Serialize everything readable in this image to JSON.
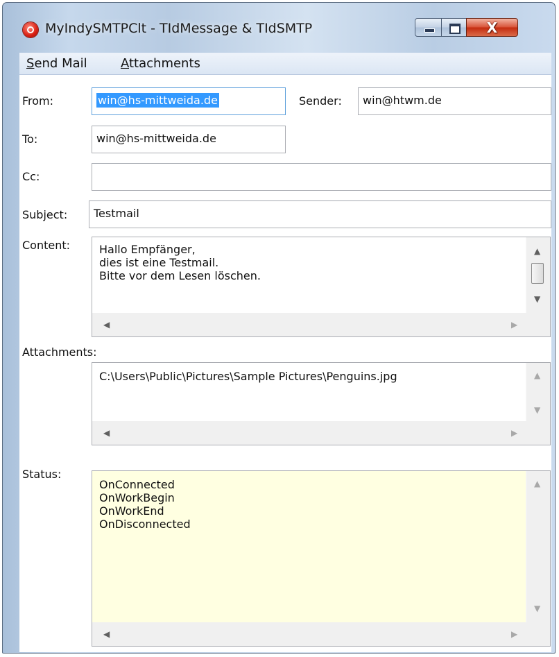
{
  "window": {
    "title": "MyIndySMTPClt - TIdMessage & TIdSMTP",
    "close_label": "X"
  },
  "menu": {
    "send_mail": {
      "accel": "S",
      "rest": "end Mail"
    },
    "attachments": {
      "accel": "A",
      "rest": "ttachments"
    }
  },
  "form": {
    "from_label": "From:",
    "from_value": "win@hs-mittweida.de",
    "sender_label": "Sender:",
    "sender_value": "win@htwm.de",
    "to_label": "To:",
    "to_value": "win@hs-mittweida.de",
    "cc_label": "Cc:",
    "cc_value": "",
    "subject_label": "Subject:",
    "subject_value": "Testmail",
    "content_label": "Content:",
    "content_lines": [
      "Hallo Empfänger,",
      "dies ist eine Testmail.",
      "Bitte vor dem Lesen löschen."
    ],
    "attachments_label": "Attachments:",
    "attachment_lines": [
      "C:\\Users\\Public\\Pictures\\Sample Pictures\\Penguins.jpg"
    ],
    "status_label": "Status:",
    "status_lines": [
      "OnConnected",
      "OnWorkBegin",
      "OnWorkEnd",
      "OnDisconnected"
    ]
  },
  "colors": {
    "status_bg": "#ffffe1",
    "selection": "#3399ff",
    "close_button": "#c42c10"
  }
}
